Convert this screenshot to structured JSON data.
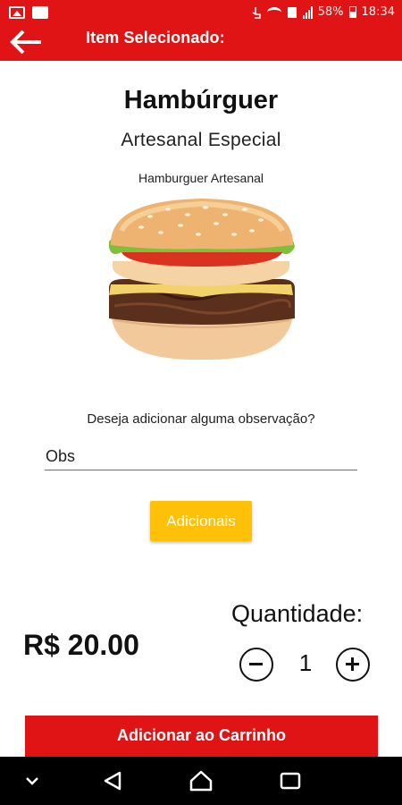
{
  "status_bar": {
    "battery": "58%",
    "time": "18:34"
  },
  "app_bar": {
    "title": "Item Selecionado:",
    "back_icon": "arrow-left-icon"
  },
  "product": {
    "name": "Hambúrguer",
    "subtitle": "Artesanal Especial",
    "description": "Hamburguer Artesanal",
    "image": "hamburger-photo"
  },
  "observation": {
    "question": "Deseja adicionar alguma observação?",
    "placeholder": "Obs"
  },
  "addons_button": "Adicionais",
  "price": "R$ 20.00",
  "quantity": {
    "label": "Quantidade:",
    "value": "1",
    "decrement_icon": "minus-circle-icon",
    "increment_icon": "plus-circle-icon"
  },
  "cart_button": "Adicionar ao Carrinho",
  "colors": {
    "primary": "#e01414",
    "accent": "#ffc107"
  },
  "nav_bar": [
    "chevron-down-icon",
    "back-triangle-icon",
    "home-icon",
    "recents-icon"
  ]
}
